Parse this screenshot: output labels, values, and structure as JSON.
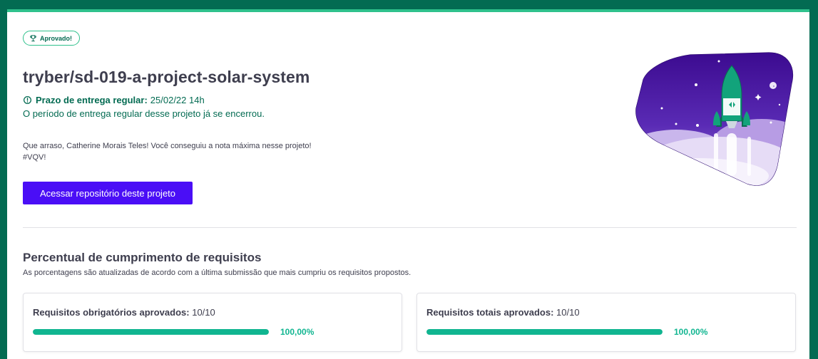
{
  "badge": {
    "label": "Aprovado!",
    "icon": "trophy-icon"
  },
  "project": {
    "title": "tryber/sd-019-a-project-solar-system",
    "deadline_label": "Prazo de entrega regular:",
    "deadline_value": "25/02/22 14h",
    "closed_message": "O período de entrega regular desse projeto já se encerrou.",
    "congrats_line1": "Que arraso, Catherine Morais Teles! Você conseguiu a nota máxima nesse projeto!",
    "congrats_line2": "#VQV!",
    "repo_button": "Acessar repositório deste projeto"
  },
  "requirements": {
    "title": "Percentual de cumprimento de requisitos",
    "subtitle": "As porcentagens são atualizadas de acordo com a última submissão que mais cumpriu os requisitos propostos.",
    "cards": [
      {
        "label": "Requisitos obrigatórios aprovados:",
        "value": "10/10",
        "percent_text": "100,00%",
        "progress": 1.0
      },
      {
        "label": "Requisitos totais aprovados:",
        "value": "10/10",
        "percent_text": "100,00%",
        "progress": 1.0
      }
    ]
  },
  "colors": {
    "header_green": "#036b52",
    "accent_green": "#2fc18c",
    "progress_green": "#10b590",
    "button_purple": "#4a0ef6",
    "illustration_purple": "#3d0e9c"
  }
}
